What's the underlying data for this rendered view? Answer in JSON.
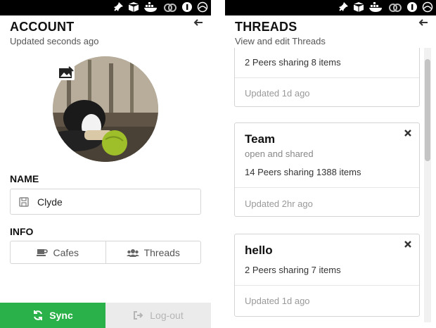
{
  "account": {
    "title": "ACCOUNT",
    "subtitle": "Updated seconds ago",
    "name_label": "NAME",
    "name_value": "Clyde",
    "info_label": "INFO",
    "info_buttons": [
      {
        "label": "Cafes",
        "icon": "coffee-cup-icon"
      },
      {
        "label": "Threads",
        "icon": "users-icon"
      }
    ],
    "sync_label": "Sync",
    "logout_label": "Log-out",
    "colors": {
      "sync": "#2bb14a",
      "logout_bg": "#ebebeb"
    }
  },
  "threads": {
    "title": "THREADS",
    "subtitle": "View and edit Threads",
    "items": [
      {
        "name": "",
        "description": "",
        "peers": "2 Peers sharing 8 items",
        "updated": "Updated 1d ago"
      },
      {
        "name": "Team",
        "description": "open and shared",
        "peers": "14 Peers sharing 1388 items",
        "updated": "Updated 2hr ago"
      },
      {
        "name": "hello",
        "description": "",
        "peers": "2 Peers sharing 7 items",
        "updated": "Updated 1d ago"
      }
    ]
  },
  "tray_icons": [
    "pin-icon",
    "package-icon",
    "docker-icon",
    "creative-cloud-icon",
    "onepassword-icon",
    "speed-icon"
  ]
}
